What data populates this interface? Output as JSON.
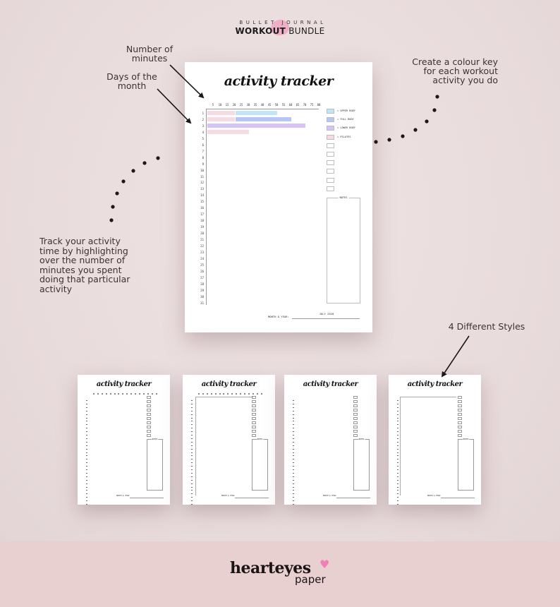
{
  "header": {
    "brand_line1": "BULLET JOURNAL",
    "brand_line2_bold": "WORKOUT",
    "brand_line2_rest": " BUNDLE",
    "accent_color": "#f0a6c3"
  },
  "annotations": {
    "number_of_minutes": "Number of\nminutes",
    "days_of_month": "Days of the\nmonth",
    "colour_key": "Create a colour key\nfor each workout\nactivity you do",
    "track_activity": "Track your activity\ntime by highlighting\nover the number of\nminutes you spent\ndoing that particular\nactivity",
    "different_styles": "4 Different Styles"
  },
  "main_page": {
    "title": "activity tracker",
    "minute_ticks": [
      "5",
      "10",
      "15",
      "20",
      "25",
      "30",
      "35",
      "40",
      "45",
      "50",
      "55",
      "60",
      "65",
      "70",
      "75",
      "80"
    ],
    "days": [
      "1",
      "2",
      "3",
      "4",
      "5",
      "6",
      "7",
      "8",
      "9",
      "10",
      "11",
      "12",
      "13",
      "14",
      "15",
      "16",
      "17",
      "18",
      "19",
      "20",
      "21",
      "22",
      "23",
      "24",
      "25",
      "26",
      "27",
      "28",
      "29",
      "30",
      "31"
    ],
    "legend": [
      {
        "label": "= UPPER BODY",
        "color": "#bfe6f7"
      },
      {
        "label": "= FULL BODY",
        "color": "#b6c6f5"
      },
      {
        "label": "= LOWER BODY",
        "color": "#d5c3f7"
      },
      {
        "label": "= PILATES",
        "color": "#f6dbe4"
      },
      {
        "label": "",
        "color": "#ffffff"
      },
      {
        "label": "",
        "color": "#ffffff"
      },
      {
        "label": "",
        "color": "#ffffff"
      },
      {
        "label": "",
        "color": "#ffffff"
      },
      {
        "label": "",
        "color": "#ffffff"
      },
      {
        "label": "",
        "color": "#ffffff"
      }
    ],
    "notes_label": "NOTES",
    "month_label": "MONTH & YEAR:",
    "month_value": "JULY 2020"
  },
  "chart_data": {
    "type": "bar",
    "orientation": "horizontal-stacked",
    "title": "activity tracker",
    "xlabel": "Number of minutes",
    "ylabel": "Days of the month",
    "xlim": [
      0,
      80
    ],
    "categories": [
      "1",
      "2",
      "3",
      "4"
    ],
    "segments": [
      {
        "day": "1",
        "activity": "PILATES",
        "start": 0,
        "end": 20
      },
      {
        "day": "1",
        "activity": "UPPER BODY",
        "start": 20,
        "end": 50
      },
      {
        "day": "2",
        "activity": "PILATES",
        "start": 0,
        "end": 20
      },
      {
        "day": "2",
        "activity": "FULL BODY",
        "start": 20,
        "end": 60
      },
      {
        "day": "3",
        "activity": "LOWER BODY",
        "start": 0,
        "end": 70
      },
      {
        "day": "4",
        "activity": "PILATES",
        "start": 0,
        "end": 30
      }
    ]
  },
  "thumbnails": [
    {
      "title": "activity tracker",
      "style": "dotted-ticks",
      "notes_label": "NOTES",
      "month_label": "MONTH & YEAR:"
    },
    {
      "title": "activity tracker",
      "style": "ticks-with-axis",
      "notes_label": "NOTES",
      "month_label": "MONTH & YEAR:"
    },
    {
      "title": "activity tracker",
      "style": "no-ticks",
      "notes_label": "NOTES",
      "month_label": "MONTH & YEAR:"
    },
    {
      "title": "activity tracker",
      "style": "box-frame",
      "notes_label": "NOTES",
      "month_label": "MONTH & YEAR:"
    }
  ],
  "footer": {
    "logo_word1": "hearteyes",
    "logo_word2": "paper",
    "heart_glyph": "♥",
    "heart_color": "#ef7fb4"
  }
}
